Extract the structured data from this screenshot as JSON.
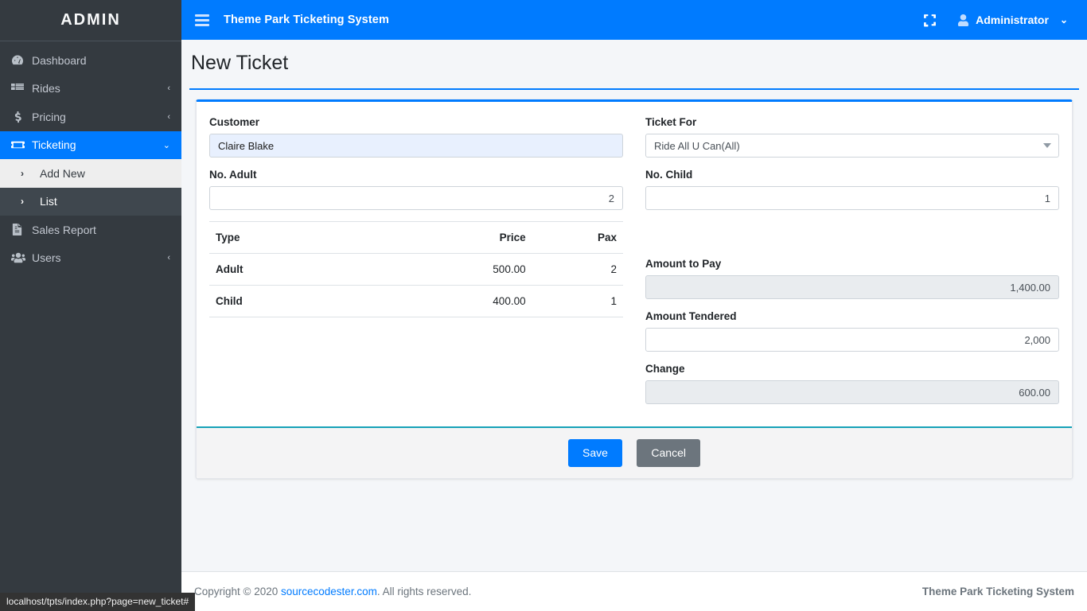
{
  "sidebar": {
    "brand": "ADMIN",
    "items": [
      {
        "label": "Dashboard",
        "icon": "dashboard-gauge-icon",
        "arrow": ""
      },
      {
        "label": "Rides",
        "icon": "grid-list-icon",
        "arrow": "‹"
      },
      {
        "label": "Pricing",
        "icon": "dollar-sign-icon",
        "arrow": "‹"
      },
      {
        "label": "Ticketing",
        "icon": "ticket-icon",
        "arrow": "⌄",
        "active": true
      },
      {
        "label": "Sales Report",
        "icon": "file-invoice-icon",
        "arrow": ""
      },
      {
        "label": "Users",
        "icon": "users-icon",
        "arrow": "‹"
      }
    ],
    "subitems": [
      {
        "label": "Add New",
        "chevron": "›",
        "state": "active"
      },
      {
        "label": "List",
        "chevron": "›",
        "state": "hover"
      }
    ]
  },
  "topbar": {
    "title": "Theme Park Ticketing System",
    "hamburger_icon": "hamburger-menu-icon",
    "fullscreen_icon": "fullscreen-expand-icon",
    "user_icon": "user-avatar-icon",
    "user_name": "Administrator",
    "user_caret": "⌄"
  },
  "page": {
    "title": "New Ticket"
  },
  "form": {
    "customer": {
      "label": "Customer",
      "value": "Claire Blake"
    },
    "ticket_for": {
      "label": "Ticket For",
      "value": "Ride All U Can(All)"
    },
    "no_adult": {
      "label": "No. Adult",
      "value": "2"
    },
    "no_child": {
      "label": "No. Child",
      "value": "1"
    },
    "amount_to_pay": {
      "label": "Amount to Pay",
      "value": "1,400.00"
    },
    "amount_tendered": {
      "label": "Amount Tendered",
      "value": "2,000"
    },
    "change": {
      "label": "Change",
      "value": "600.00"
    }
  },
  "pricing_table": {
    "headers": {
      "type": "Type",
      "price": "Price",
      "pax": "Pax"
    },
    "rows": [
      {
        "type": "Adult",
        "price": "500.00",
        "pax": "2"
      },
      {
        "type": "Child",
        "price": "400.00",
        "pax": "1"
      }
    ]
  },
  "actions": {
    "save": "Save",
    "cancel": "Cancel"
  },
  "footer": {
    "copyright_prefix": "Copyright © 2020 ",
    "link": "sourcecodester.com",
    "copyright_suffix": ". All rights reserved.",
    "right": "Theme Park Ticketing System"
  },
  "browser": {
    "status_url": "localhost/tpts/index.php?page=new_ticket#"
  },
  "colors": {
    "accent_blue": "#007bff",
    "sidebar_dark": "#343a40",
    "footer_divider_teal": "#17a2b8",
    "autofill_blue": "#e8f0fe",
    "readonly_gray": "#e9ecef"
  }
}
